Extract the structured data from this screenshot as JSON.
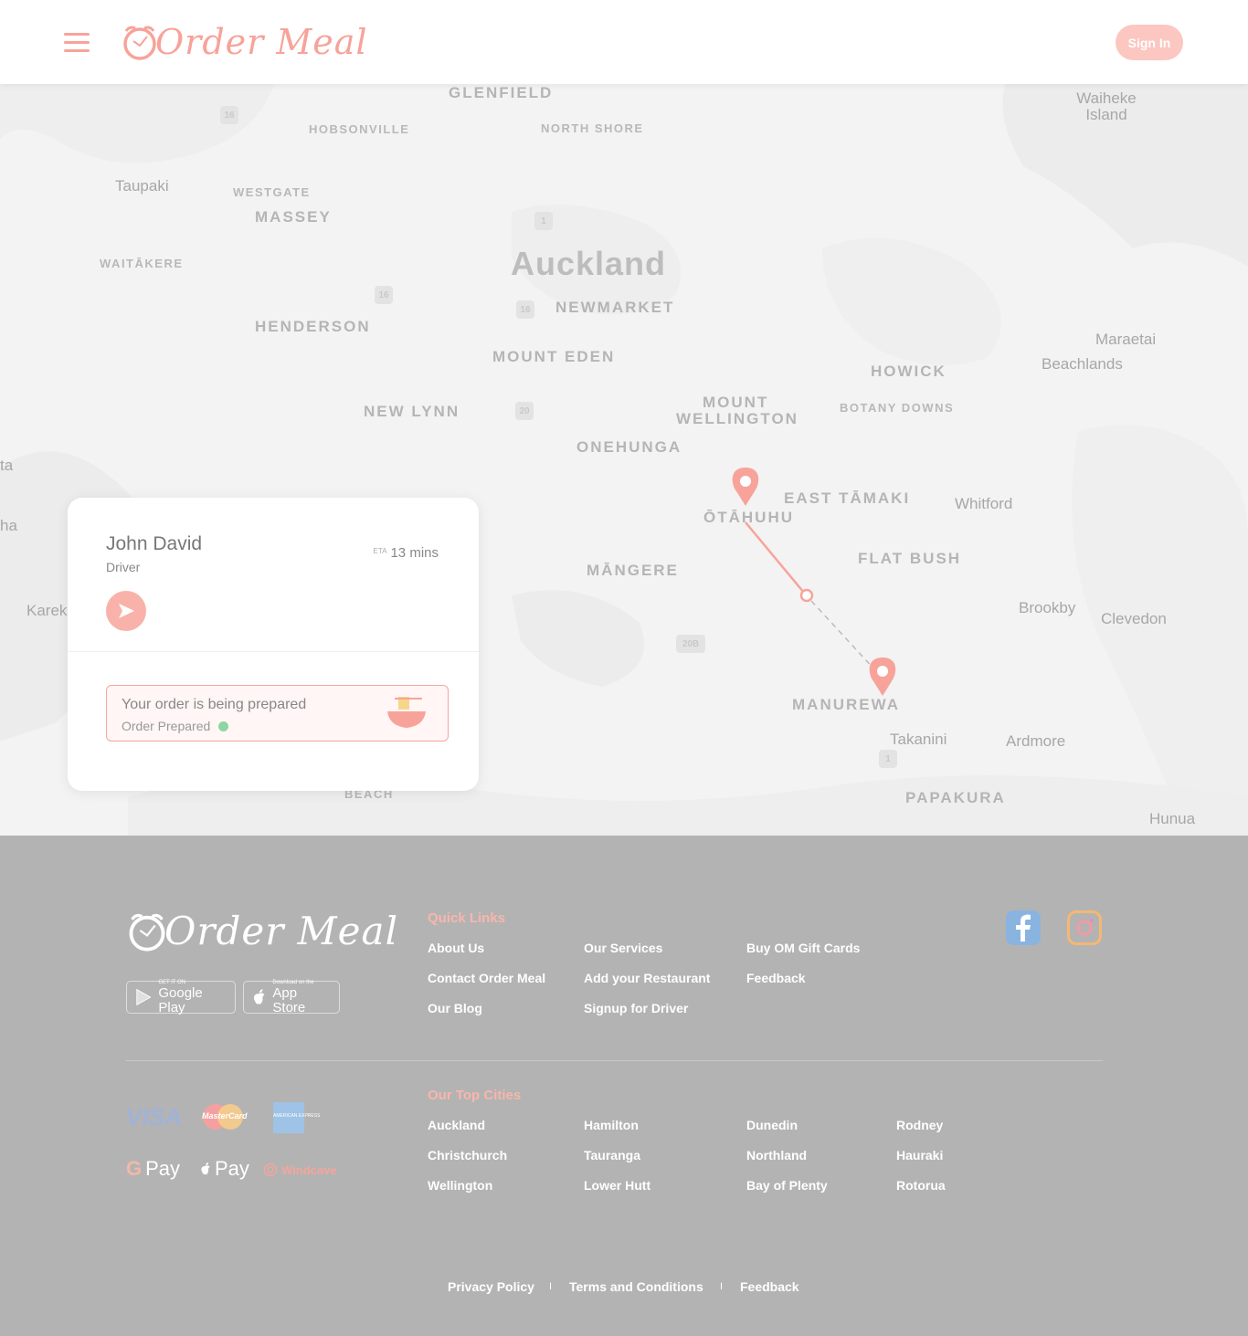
{
  "header": {
    "brand": "Order Meal",
    "sign_in_label": "Sign In"
  },
  "map": {
    "places": {
      "glenfield": "GLENFIELD",
      "hobsonville": "HOBSONVILLE",
      "north_shore": "NORTH SHORE",
      "waiheke": "Waiheke Island",
      "taupaki": "Taupaki",
      "westgate": "WESTGATE",
      "massey": "MASSEY",
      "waitakere": "WAITĀKERE",
      "auckland": "Auckland",
      "newmarket": "NEWMARKET",
      "henderson": "HENDERSON",
      "mount_eden": "MOUNT EDEN",
      "maraetai": "Maraetai",
      "beachlands": "Beachlands",
      "howick": "HOWICK",
      "botany_downs": "BOTANY DOWNS",
      "new_lynn": "NEW LYNN",
      "mount_wellington_1": "MOUNT",
      "mount_wellington_2": "WELLINGTON",
      "onehunga": "ONEHUNGA",
      "otahuhu": "ŌTĀHUHU",
      "east_tamaki": "EAST TĀMAKI",
      "whitford": "Whitford",
      "mangere": "MĀNGERE",
      "flat_bush": "FLAT BUSH",
      "brookby": "Brookby",
      "clevedon": "Clevedon",
      "manurewa": "MANUREWA",
      "takanini": "Takanini",
      "ardmore": "Ardmore",
      "papakura": "PAPAKURA",
      "hunua": "Hunua",
      "karek": "Karek",
      "edge_ta": "ta",
      "edge_ha": "ha",
      "beach": "BEACH"
    },
    "shields": [
      "16",
      "1",
      "16",
      "16",
      "20",
      "20B",
      "1"
    ]
  },
  "driver_card": {
    "name": "John David",
    "role": "Driver",
    "eta_label": "ETA",
    "eta_value": "13 mins",
    "status_title": "Your order is being prepared",
    "status_sub": "Order Prepared"
  },
  "footer": {
    "brand": "Order Meal",
    "google_play": {
      "small": "GET IT ON",
      "big": "Google Play"
    },
    "app_store": {
      "small": "Download on the",
      "big": "App Store"
    },
    "quick_links_heading": "Quick Links",
    "quick_links": [
      "About Us",
      "Our Services",
      "Buy OM Gift Cards",
      "Contact Order Meal",
      "Add your Restaurant",
      "Feedback",
      "Our Blog",
      "Signup for Driver"
    ],
    "top_cities_heading": "Our Top Cities",
    "cities": [
      "Auckland",
      "Hamilton",
      "Dunedin",
      "Rodney",
      "Christchurch",
      "Tauranga",
      "Northland",
      "Hauraki",
      "Wellington",
      "Lower Hutt",
      "Bay of Plenty",
      "Rotorua"
    ],
    "payments": {
      "visa": "VISA",
      "mastercard": "MasterCard",
      "amex": "AMERICAN EXPRESS",
      "gpay": "Pay",
      "applepay": "Pay",
      "windcave": "Windcave"
    },
    "legal": [
      "Privacy Policy",
      "Terms and Conditions",
      "Feedback"
    ],
    "separator": "I"
  },
  "colors": {
    "accent": "#f7a39a",
    "footer_bg": "#b3b3b3",
    "map_bg": "#f3f3f3"
  }
}
